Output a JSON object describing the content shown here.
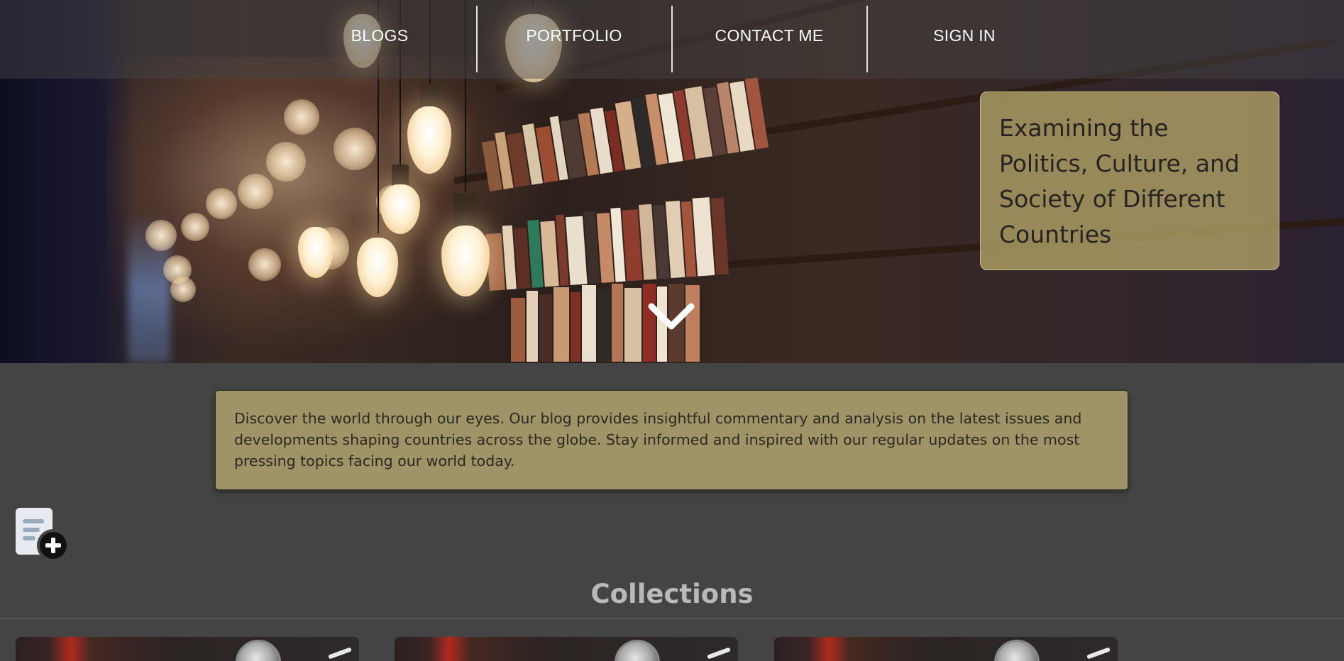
{
  "nav": {
    "items": [
      {
        "label": "BLOGS"
      },
      {
        "label": "PORTFOLIO"
      },
      {
        "label": "CONTACT ME"
      },
      {
        "label": "SIGN IN"
      }
    ]
  },
  "hero": {
    "headline": "Examining the Politics, Culture, and Society of Different Countries",
    "scroll_icon": "chevron-down-icon"
  },
  "intro": {
    "text": "Discover the world through our eyes. Our blog provides insightful commentary and analysis on the latest issues and developments shaping countries across the globe. Stay informed and inspired with our regular updates on the most pressing topics facing our world today."
  },
  "add_post": {
    "icon": "document-add-icon"
  },
  "collections": {
    "title": "Collections",
    "cards": [
      {
        "image": "collection-image"
      },
      {
        "image": "collection-image"
      },
      {
        "image": "collection-image"
      }
    ]
  },
  "colors": {
    "page_background": "#444444",
    "card_gold": "#9f9467",
    "hero_card": "#b5a569",
    "nav_text": "#ffffff"
  }
}
